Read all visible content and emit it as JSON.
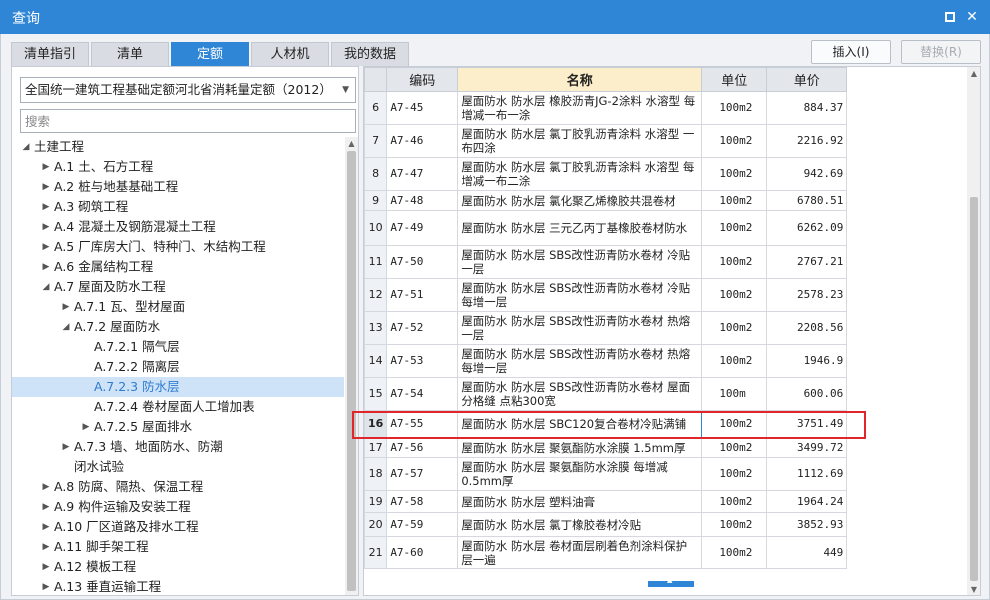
{
  "window": {
    "title": "查询",
    "maximize_label": "",
    "close_label": "✕"
  },
  "tabs": [
    {
      "label": "清单指引"
    },
    {
      "label": "清单"
    },
    {
      "label": "定额"
    },
    {
      "label": "人材机"
    },
    {
      "label": "我的数据"
    }
  ],
  "active_tab": "定额",
  "toolbar": {
    "insert_label": "插入(I)",
    "replace_label": "替换(R)"
  },
  "left": {
    "library_select": "全国统一建筑工程基础定额河北省消耗量定额（2012）",
    "search_placeholder": "搜索",
    "tree": [
      {
        "label": "土建工程",
        "arrow": "◢"
      },
      {
        "label": "A.1 土、石方工程",
        "arrow": "▶"
      },
      {
        "label": "A.2 桩与地基基础工程",
        "arrow": "▶"
      },
      {
        "label": "A.3 砌筑工程",
        "arrow": "▶"
      },
      {
        "label": "A.4 混凝土及钢筋混凝土工程",
        "arrow": "▶"
      },
      {
        "label": "A.5 厂库房大门、特种门、木结构工程",
        "arrow": "▶"
      },
      {
        "label": "A.6 金属结构工程",
        "arrow": "▶"
      },
      {
        "label": "A.7 屋面及防水工程",
        "arrow": "◢"
      },
      {
        "label": "A.7.1 瓦、型材屋面",
        "arrow": "▶"
      },
      {
        "label": "A.7.2 屋面防水",
        "arrow": "◢"
      },
      {
        "label": "A.7.2.1 隔气层",
        "arrow": ""
      },
      {
        "label": "A.7.2.2 隔离层",
        "arrow": ""
      },
      {
        "label": "A.7.2.3 防水层",
        "arrow": ""
      },
      {
        "label": "A.7.2.4 卷材屋面人工增加表",
        "arrow": ""
      },
      {
        "label": "A.7.2.5 屋面排水",
        "arrow": "▶"
      },
      {
        "label": "A.7.3 墙、地面防水、防潮",
        "arrow": "▶"
      },
      {
        "label": "闭水试验",
        "arrow": ""
      },
      {
        "label": "A.8 防腐、隔热、保温工程",
        "arrow": "▶"
      },
      {
        "label": "A.9 构件运输及安装工程",
        "arrow": "▶"
      },
      {
        "label": "A.10 厂区道路及排水工程",
        "arrow": "▶"
      },
      {
        "label": "A.11 脚手架工程",
        "arrow": "▶"
      },
      {
        "label": "A.12 模板工程",
        "arrow": "▶"
      },
      {
        "label": "A.13 垂直运输工程",
        "arrow": "▶"
      }
    ]
  },
  "grid": {
    "columns": [
      "编码",
      "名称",
      "单位",
      "单价"
    ],
    "rows": [
      {
        "idx": "6",
        "code": "A7-45",
        "name": "屋面防水 防水层 橡胶沥青JG-2涂料 水溶型 每增减一布一涂",
        "unit": "100m2",
        "price": "884.37"
      },
      {
        "idx": "7",
        "code": "A7-46",
        "name": "屋面防水 防水层 氯丁胶乳沥青涂料 水溶型 一布四涂",
        "unit": "100m2",
        "price": "2216.92"
      },
      {
        "idx": "8",
        "code": "A7-47",
        "name": "屋面防水 防水层 氯丁胶乳沥青涂料 水溶型 每增减一布二涂",
        "unit": "100m2",
        "price": "942.69"
      },
      {
        "idx": "9",
        "code": "A7-48",
        "name": "屋面防水 防水层 氯化聚乙烯橡胶共混卷材",
        "unit": "100m2",
        "price": "6780.51"
      },
      {
        "idx": "10",
        "code": "A7-49",
        "name": "屋面防水 防水层 三元乙丙丁基橡胶卷材防水",
        "unit": "100m2",
        "price": "6262.09"
      },
      {
        "idx": "11",
        "code": "A7-50",
        "name": "屋面防水 防水层 SBS改性沥青防水卷材 冷贴 一层",
        "unit": "100m2",
        "price": "2767.21"
      },
      {
        "idx": "12",
        "code": "A7-51",
        "name": "屋面防水 防水层 SBS改性沥青防水卷材 冷贴 每增一层",
        "unit": "100m2",
        "price": "2578.23"
      },
      {
        "idx": "13",
        "code": "A7-52",
        "name": "屋面防水 防水层 SBS改性沥青防水卷材 热熔 一层",
        "unit": "100m2",
        "price": "2208.56"
      },
      {
        "idx": "14",
        "code": "A7-53",
        "name": "屋面防水 防水层 SBS改性沥青防水卷材 热熔 每增一层",
        "unit": "100m2",
        "price": "1946.9"
      },
      {
        "idx": "15",
        "code": "A7-54",
        "name": "屋面防水 防水层 SBS改性沥青防水卷材 屋面分格缝 点粘300宽",
        "unit": "100m",
        "price": "600.06"
      },
      {
        "idx": "16",
        "code": "A7-55",
        "name": "屋面防水 防水层 SBC120复合卷材冷贴满铺",
        "unit": "100m2",
        "price": "3751.49"
      },
      {
        "idx": "17",
        "code": "A7-56",
        "name": "屋面防水 防水层 聚氨酯防水涂膜 1.5mm厚",
        "unit": "100m2",
        "price": "3499.72"
      },
      {
        "idx": "18",
        "code": "A7-57",
        "name": "屋面防水 防水层 聚氨酯防水涂膜 每增减0.5mm厚",
        "unit": "100m2",
        "price": "1112.69"
      },
      {
        "idx": "19",
        "code": "A7-58",
        "name": "屋面防水 防水层 塑料油膏",
        "unit": "100m2",
        "price": "1964.24"
      },
      {
        "idx": "20",
        "code": "A7-59",
        "name": "屋面防水 防水层 氯丁橡胶卷材冷贴",
        "unit": "100m2",
        "price": "3852.93"
      },
      {
        "idx": "21",
        "code": "A7-60",
        "name": "屋面防水 防水层 卷材面层刷着色剂涂料保护层一遍",
        "unit": "100m2",
        "price": "449"
      }
    ]
  },
  "colors": {
    "accent": "#2f86d6",
    "highlight": "#e0262b",
    "name_header": "#fdeecb",
    "tree_selected": "#cfe3f8"
  }
}
